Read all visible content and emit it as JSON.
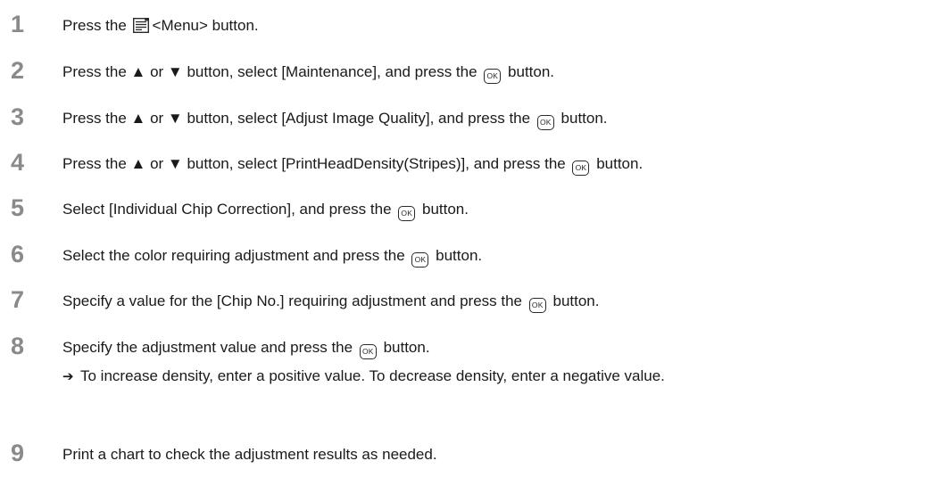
{
  "steps": [
    {
      "num": "1",
      "pre": "Press the",
      "post": "<Menu> button."
    },
    {
      "num": "2",
      "pre": "Press the ▲ or ▼ button, select [Maintenance], and press the",
      "post": "button."
    },
    {
      "num": "3",
      "pre": "Press the ▲ or ▼ button, select [Adjust Image Quality], and press the",
      "post": "button."
    },
    {
      "num": "4",
      "pre": "Press the ▲ or ▼ button, select [PrintHeadDensity(Stripes)], and press the",
      "post": "button."
    },
    {
      "num": "5",
      "pre": "Select [Individual Chip Correction], and press the",
      "post": "button."
    },
    {
      "num": "6",
      "pre": "Select the color requiring adjustment and press the",
      "post": "button."
    },
    {
      "num": "7",
      "pre": "Specify a value for the [Chip No.] requiring adjustment and press the",
      "post": "button."
    },
    {
      "num": "8",
      "pre": "Specify the adjustment value and press the",
      "post": "button."
    },
    {
      "num": "9",
      "text": "Print a chart to check the adjustment results as needed."
    }
  ],
  "sub_step": {
    "arrow": "➔",
    "text": "To increase density, enter a positive value. To decrease density, enter a negative value."
  },
  "icons": {
    "ok_label": "OK"
  }
}
